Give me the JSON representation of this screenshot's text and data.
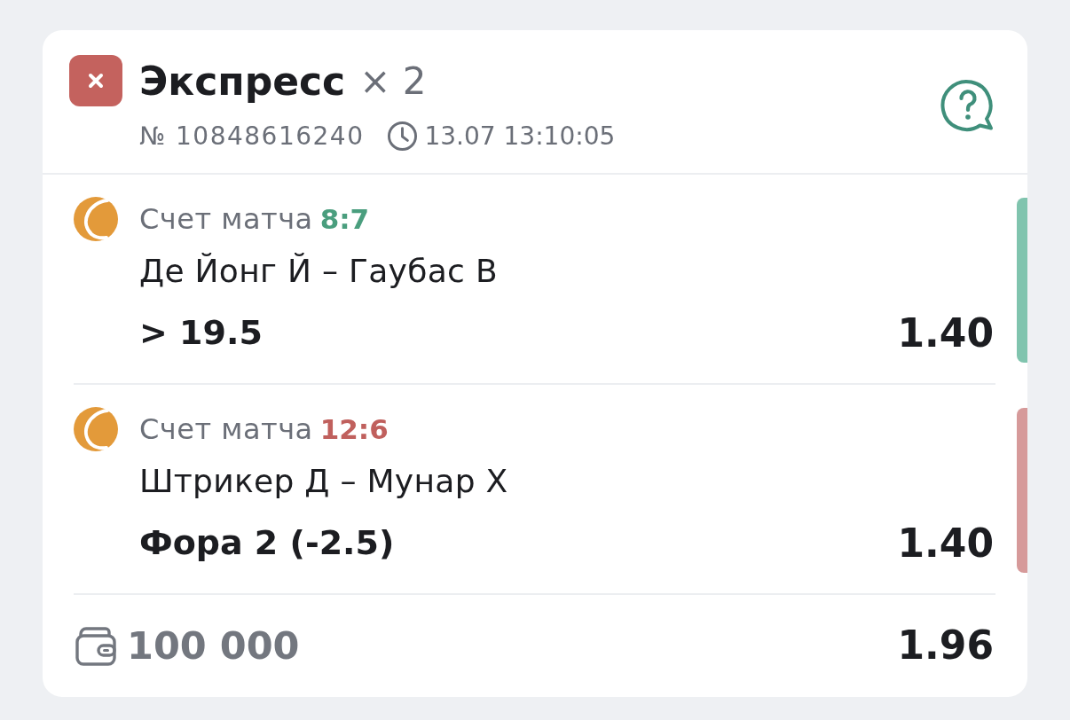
{
  "bet": {
    "won": false,
    "title": "Экспресс",
    "multiplier": "× 2",
    "number": "№ 10848616240",
    "datetime": "13.07 13:10:05"
  },
  "selections": [
    {
      "won": true,
      "label": "Счет матча",
      "score": "8:7",
      "teams": "Де Йонг Й – Гаубас В",
      "market": "> 19.5",
      "odds": "1.40"
    },
    {
      "won": false,
      "label": "Счет матча",
      "score": "12:6",
      "teams": "Штрикер Д – Мунар Х",
      "market": "Фора 2 (-2.5)",
      "odds": "1.40"
    }
  ],
  "footer": {
    "stake": "100 000",
    "total_odds": "1.96"
  }
}
